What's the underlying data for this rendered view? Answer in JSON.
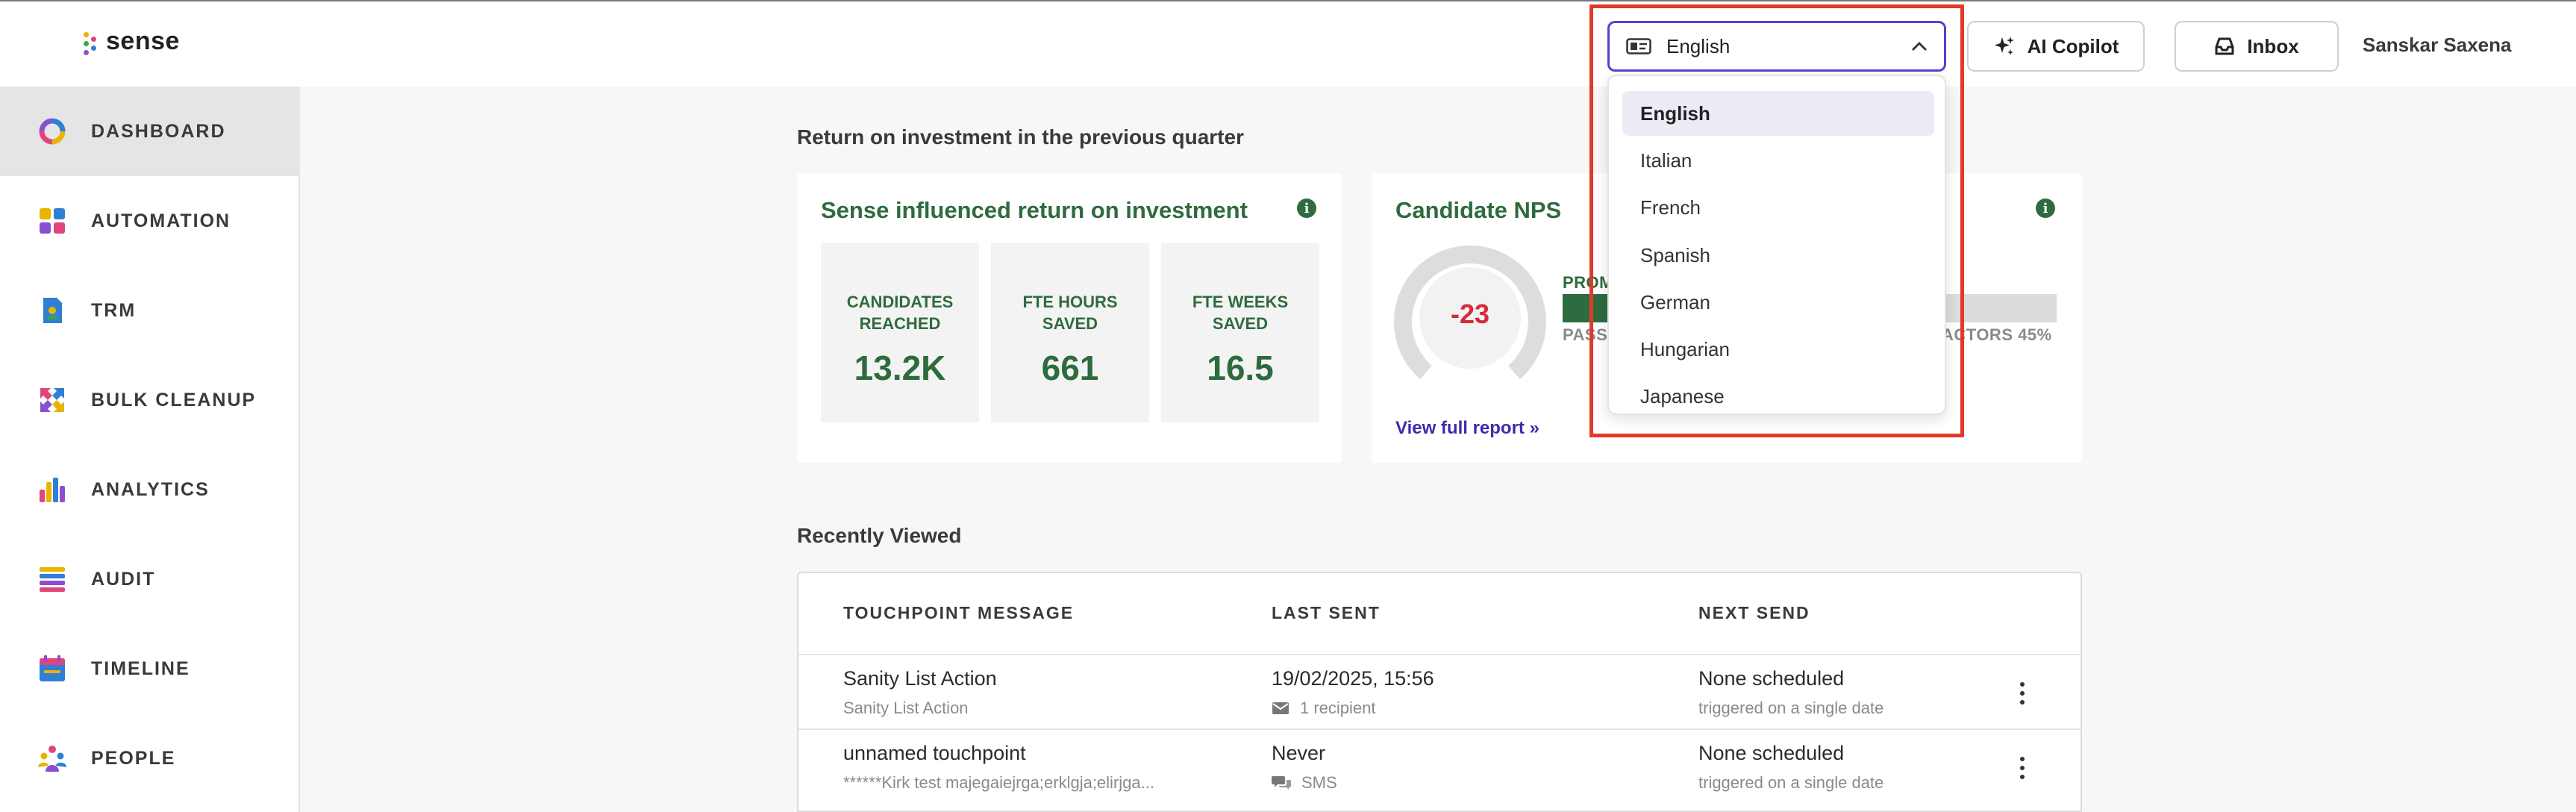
{
  "app": {
    "logo_text": "sense"
  },
  "header": {
    "language_selected": "English",
    "copilot_label": "AI Copilot",
    "inbox_label": "Inbox",
    "user_name": "Sanskar Saxena"
  },
  "language_options": [
    "English",
    "Italian",
    "French",
    "Spanish",
    "German",
    "Hungarian",
    "Japanese"
  ],
  "sidebar": {
    "items": [
      {
        "label": "DASHBOARD",
        "icon": "dashboard-ring-icon"
      },
      {
        "label": "AUTOMATION",
        "icon": "automation-grid-icon"
      },
      {
        "label": "TRM",
        "icon": "trm-document-icon"
      },
      {
        "label": "BULK CLEANUP",
        "icon": "bulk-cleanup-arrows-icon"
      },
      {
        "label": "ANALYTICS",
        "icon": "analytics-bars-icon"
      },
      {
        "label": "AUDIT",
        "icon": "audit-list-icon"
      },
      {
        "label": "TIMELINE",
        "icon": "timeline-calendar-icon"
      },
      {
        "label": "PEOPLE",
        "icon": "people-group-icon"
      }
    ]
  },
  "roi": {
    "section_title": "Return on investment in the previous quarter",
    "card_title": "Sense influenced return on investment",
    "stats": [
      {
        "label_line1": "CANDIDATES",
        "label_line2": "REACHED",
        "value": "13.2K"
      },
      {
        "label_line1": "FTE HOURS",
        "label_line2": "SAVED",
        "value": "661"
      },
      {
        "label_line1": "FTE WEEKS",
        "label_line2": "SAVED",
        "value": "16.5"
      }
    ]
  },
  "nps": {
    "card_title": "Candidate NPS",
    "score": "-23",
    "promoters_label": "PROM",
    "passives_label": "PASS",
    "detractors_label": "ACTORS 45%",
    "view_report": "View full report »"
  },
  "recent": {
    "section_title": "Recently Viewed",
    "columns": [
      "TOUCHPOINT MESSAGE",
      "LAST SENT",
      "NEXT SEND"
    ],
    "rows": [
      {
        "name": "Sanity List Action",
        "subtitle": "Sanity List Action",
        "last_sent": "19/02/2025, 15:56",
        "last_sent_sub": "1 recipient",
        "last_sent_icon": "envelope-icon",
        "next_send": "None scheduled",
        "next_send_sub": "triggered on a single date"
      },
      {
        "name": "unnamed touchpoint",
        "subtitle": "******Kirk test majegaiejrga;erklgja;elirjga...",
        "last_sent": "Never",
        "last_sent_sub": "SMS",
        "last_sent_icon": "chat-bubbles-icon",
        "next_send": "None scheduled",
        "next_send_sub": "triggered on a single date"
      }
    ]
  },
  "colors": {
    "accent_green": "#2e6b3e",
    "nps_red": "#d52b3a",
    "link_purple": "#3a2bb0",
    "focus_purple": "#5b3fd0",
    "highlight_red": "#e03a2b"
  }
}
